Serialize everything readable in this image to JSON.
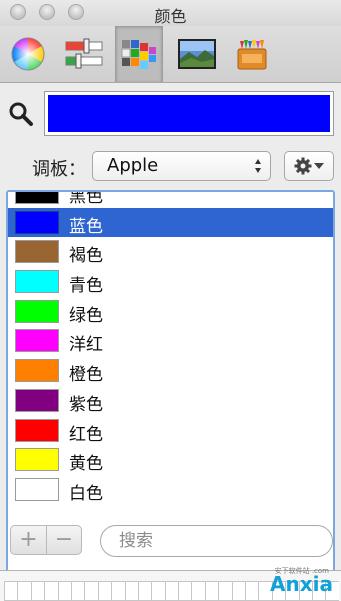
{
  "window": {
    "title": "颜色"
  },
  "toolbar": {
    "tools": [
      {
        "icon": "color-wheel-icon",
        "selected": false
      },
      {
        "icon": "color-sliders-icon",
        "selected": false
      },
      {
        "icon": "color-palettes-icon",
        "selected": true
      },
      {
        "icon": "image-palettes-icon",
        "selected": false
      },
      {
        "icon": "pencils-icon",
        "selected": false
      }
    ]
  },
  "current_color": "#0000ff",
  "palette": {
    "label": "调板：",
    "selected": "Apple"
  },
  "colors": [
    {
      "name": "黑色",
      "hex": "#000000"
    },
    {
      "name": "蓝色",
      "hex": "#0000ff",
      "selected": true
    },
    {
      "name": "褐色",
      "hex": "#996633"
    },
    {
      "name": "青色",
      "hex": "#00ffff"
    },
    {
      "name": "绿色",
      "hex": "#00ff00"
    },
    {
      "name": "洋红",
      "hex": "#ff00ff"
    },
    {
      "name": "橙色",
      "hex": "#ff8000"
    },
    {
      "name": "紫色",
      "hex": "#800080"
    },
    {
      "name": "红色",
      "hex": "#ff0000"
    },
    {
      "name": "黄色",
      "hex": "#ffff00"
    },
    {
      "name": "白色",
      "hex": "#ffffff"
    }
  ],
  "controls": {
    "add_label": "+",
    "remove_label": "−",
    "search_placeholder": "搜索"
  },
  "watermark": {
    "text": "Anxia",
    "sub": "安下软件站 .com"
  }
}
